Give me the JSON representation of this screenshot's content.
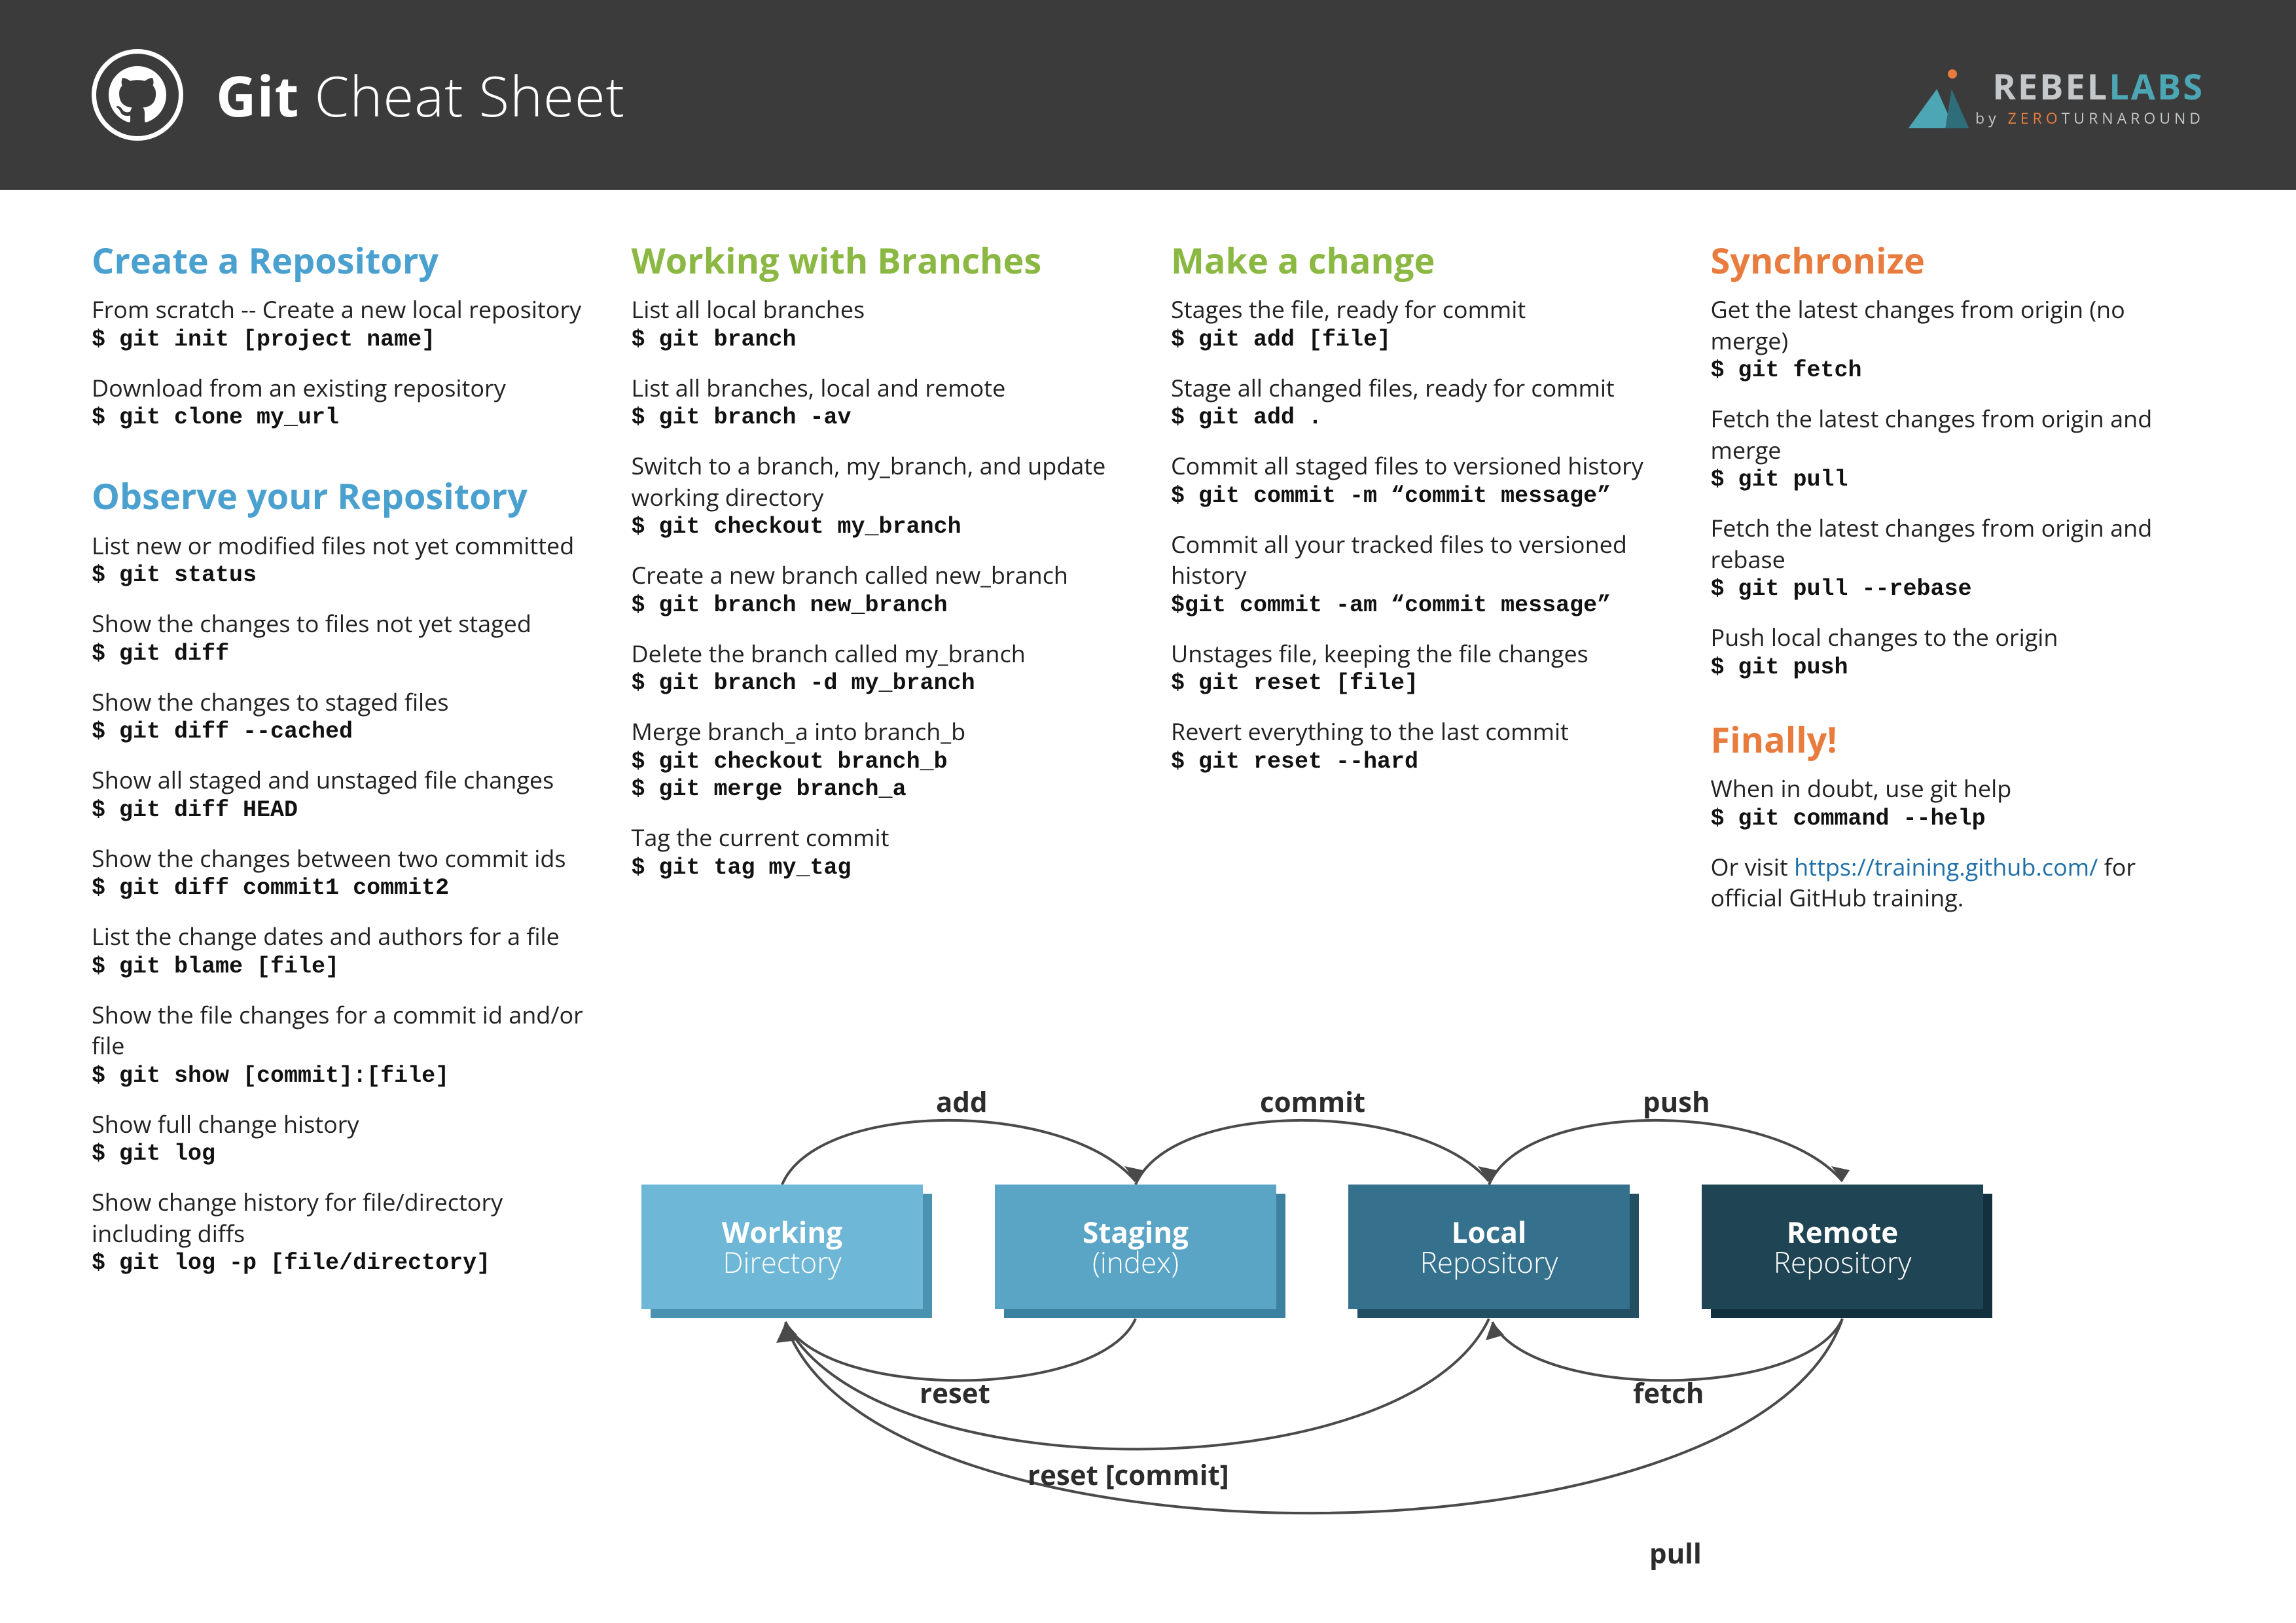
{
  "header": {
    "title_bold": "Git",
    "title_rest": " Cheat Sheet",
    "brand_a": "REBEL",
    "brand_b": "LABS",
    "brand_sub_a": "by ",
    "brand_sub_b": "ZERO",
    "brand_sub_c": "TURNAROUND"
  },
  "col1": {
    "h1": "Create a Repository",
    "i1d": "From scratch -- Create a new local repository",
    "i1c": "$ git init [project name]",
    "i2d": "Download from an existing repository",
    "i2c": "$ git clone my_url",
    "h2": "Observe your Repository",
    "o1d": "List new or modified files not yet committed",
    "o1c": "$ git status",
    "o2d": "Show the changes to files not yet staged",
    "o2c": "$ git diff",
    "o3d": "Show the changes to staged files",
    "o3c": "$ git diff --cached",
    "o4d": "Show all staged and unstaged file changes",
    "o4c": "$ git diff HEAD",
    "o5d": "Show the changes between two commit ids",
    "o5c": "$ git diff commit1 commit2",
    "o6d": "List the change dates and authors for a file",
    "o6c": "$ git blame [file]",
    "o7d": "Show the file changes for a commit id and/or file",
    "o7c": "$ git show [commit]:[file]",
    "o8d": "Show full change history",
    "o8c": "$ git log",
    "o9d": "Show change history for file/directory including diffs",
    "o9c": "$ git log -p [file/directory]"
  },
  "col2": {
    "h1": "Working with Branches",
    "b1d": "List all local branches",
    "b1c": "$ git branch",
    "b2d": "List all branches, local and remote",
    "b2c": "$ git branch -av",
    "b3d": "Switch to a branch, my_branch, and update working directory",
    "b3c": "$ git checkout my_branch",
    "b4d": "Create a new branch called new_branch",
    "b4c": "$ git branch new_branch",
    "b5d": "Delete the branch called my_branch",
    "b5c": "$ git branch -d my_branch",
    "b6d": "Merge branch_a into branch_b",
    "b6c1": "$ git checkout branch_b",
    "b6c2": "$ git merge branch_a",
    "b7d": "Tag the current commit",
    "b7c": "$ git tag my_tag"
  },
  "col3": {
    "h1": "Make a change",
    "m1d": "Stages the file, ready for commit",
    "m1c": "$ git add [file]",
    "m2d": "Stage all changed files, ready for commit",
    "m2c": "$ git add .",
    "m3d": "Commit all staged files to versioned history",
    "m3c": "$ git commit -m “commit message”",
    "m4d": "Commit all your tracked files to versioned history",
    "m4c": "$git commit -am “commit message”",
    "m5d": "Unstages file, keeping the file changes",
    "m5c": "$ git reset [file]",
    "m6d": "Revert everything to the last commit",
    "m6c": "$ git reset --hard"
  },
  "col4": {
    "h1": "Synchronize",
    "s1d": "Get the latest changes from origin (no merge)",
    "s1c": "$ git fetch",
    "s2d": "Fetch the latest changes from origin and merge",
    "s2c": "$ git pull",
    "s3d": "Fetch the latest changes from origin and rebase",
    "s3c": "$ git pull --rebase",
    "s4d": "Push local changes to the origin",
    "s4c": "$ git push",
    "h2": "Finally!",
    "f1d": "When in doubt, use git help",
    "f1c": "$ git command --help",
    "f2a": "Or visit ",
    "f2link": "https://training.github.com/",
    "f2b": " for official GitHub training."
  },
  "diagram": {
    "b1a": "Working",
    "b1b": "Directory",
    "b2a": "Staging",
    "b2b": "(index)",
    "b3a": "Local",
    "b3b": "Repository",
    "b4a": "Remote",
    "b4b": "Repository",
    "l_add": "add",
    "l_commit": "commit",
    "l_push": "push",
    "l_reset": "reset",
    "l_fetch": "fetch",
    "l_resetc": "reset [commit]",
    "l_pull": "pull"
  }
}
